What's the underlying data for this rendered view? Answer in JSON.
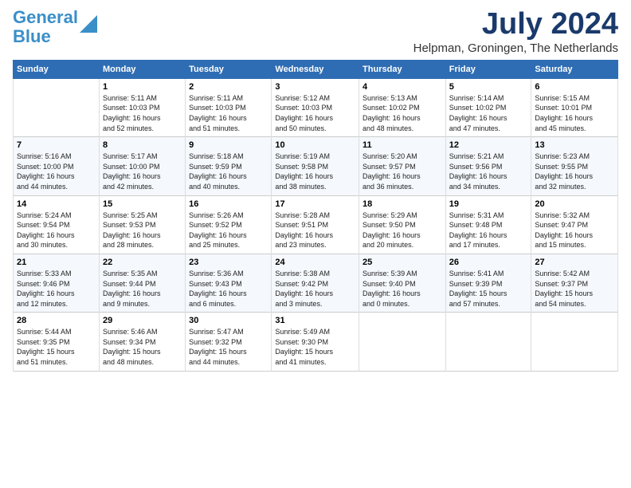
{
  "logo": {
    "line1": "General",
    "line2": "Blue"
  },
  "header": {
    "month": "July 2024",
    "location": "Helpman, Groningen, The Netherlands"
  },
  "days_of_week": [
    "Sunday",
    "Monday",
    "Tuesday",
    "Wednesday",
    "Thursday",
    "Friday",
    "Saturday"
  ],
  "weeks": [
    [
      {
        "num": "",
        "info": ""
      },
      {
        "num": "1",
        "info": "Sunrise: 5:11 AM\nSunset: 10:03 PM\nDaylight: 16 hours\nand 52 minutes."
      },
      {
        "num": "2",
        "info": "Sunrise: 5:11 AM\nSunset: 10:03 PM\nDaylight: 16 hours\nand 51 minutes."
      },
      {
        "num": "3",
        "info": "Sunrise: 5:12 AM\nSunset: 10:03 PM\nDaylight: 16 hours\nand 50 minutes."
      },
      {
        "num": "4",
        "info": "Sunrise: 5:13 AM\nSunset: 10:02 PM\nDaylight: 16 hours\nand 48 minutes."
      },
      {
        "num": "5",
        "info": "Sunrise: 5:14 AM\nSunset: 10:02 PM\nDaylight: 16 hours\nand 47 minutes."
      },
      {
        "num": "6",
        "info": "Sunrise: 5:15 AM\nSunset: 10:01 PM\nDaylight: 16 hours\nand 45 minutes."
      }
    ],
    [
      {
        "num": "7",
        "info": "Sunrise: 5:16 AM\nSunset: 10:00 PM\nDaylight: 16 hours\nand 44 minutes."
      },
      {
        "num": "8",
        "info": "Sunrise: 5:17 AM\nSunset: 10:00 PM\nDaylight: 16 hours\nand 42 minutes."
      },
      {
        "num": "9",
        "info": "Sunrise: 5:18 AM\nSunset: 9:59 PM\nDaylight: 16 hours\nand 40 minutes."
      },
      {
        "num": "10",
        "info": "Sunrise: 5:19 AM\nSunset: 9:58 PM\nDaylight: 16 hours\nand 38 minutes."
      },
      {
        "num": "11",
        "info": "Sunrise: 5:20 AM\nSunset: 9:57 PM\nDaylight: 16 hours\nand 36 minutes."
      },
      {
        "num": "12",
        "info": "Sunrise: 5:21 AM\nSunset: 9:56 PM\nDaylight: 16 hours\nand 34 minutes."
      },
      {
        "num": "13",
        "info": "Sunrise: 5:23 AM\nSunset: 9:55 PM\nDaylight: 16 hours\nand 32 minutes."
      }
    ],
    [
      {
        "num": "14",
        "info": "Sunrise: 5:24 AM\nSunset: 9:54 PM\nDaylight: 16 hours\nand 30 minutes."
      },
      {
        "num": "15",
        "info": "Sunrise: 5:25 AM\nSunset: 9:53 PM\nDaylight: 16 hours\nand 28 minutes."
      },
      {
        "num": "16",
        "info": "Sunrise: 5:26 AM\nSunset: 9:52 PM\nDaylight: 16 hours\nand 25 minutes."
      },
      {
        "num": "17",
        "info": "Sunrise: 5:28 AM\nSunset: 9:51 PM\nDaylight: 16 hours\nand 23 minutes."
      },
      {
        "num": "18",
        "info": "Sunrise: 5:29 AM\nSunset: 9:50 PM\nDaylight: 16 hours\nand 20 minutes."
      },
      {
        "num": "19",
        "info": "Sunrise: 5:31 AM\nSunset: 9:48 PM\nDaylight: 16 hours\nand 17 minutes."
      },
      {
        "num": "20",
        "info": "Sunrise: 5:32 AM\nSunset: 9:47 PM\nDaylight: 16 hours\nand 15 minutes."
      }
    ],
    [
      {
        "num": "21",
        "info": "Sunrise: 5:33 AM\nSunset: 9:46 PM\nDaylight: 16 hours\nand 12 minutes."
      },
      {
        "num": "22",
        "info": "Sunrise: 5:35 AM\nSunset: 9:44 PM\nDaylight: 16 hours\nand 9 minutes."
      },
      {
        "num": "23",
        "info": "Sunrise: 5:36 AM\nSunset: 9:43 PM\nDaylight: 16 hours\nand 6 minutes."
      },
      {
        "num": "24",
        "info": "Sunrise: 5:38 AM\nSunset: 9:42 PM\nDaylight: 16 hours\nand 3 minutes."
      },
      {
        "num": "25",
        "info": "Sunrise: 5:39 AM\nSunset: 9:40 PM\nDaylight: 16 hours\nand 0 minutes."
      },
      {
        "num": "26",
        "info": "Sunrise: 5:41 AM\nSunset: 9:39 PM\nDaylight: 15 hours\nand 57 minutes."
      },
      {
        "num": "27",
        "info": "Sunrise: 5:42 AM\nSunset: 9:37 PM\nDaylight: 15 hours\nand 54 minutes."
      }
    ],
    [
      {
        "num": "28",
        "info": "Sunrise: 5:44 AM\nSunset: 9:35 PM\nDaylight: 15 hours\nand 51 minutes."
      },
      {
        "num": "29",
        "info": "Sunrise: 5:46 AM\nSunset: 9:34 PM\nDaylight: 15 hours\nand 48 minutes."
      },
      {
        "num": "30",
        "info": "Sunrise: 5:47 AM\nSunset: 9:32 PM\nDaylight: 15 hours\nand 44 minutes."
      },
      {
        "num": "31",
        "info": "Sunrise: 5:49 AM\nSunset: 9:30 PM\nDaylight: 15 hours\nand 41 minutes."
      },
      {
        "num": "",
        "info": ""
      },
      {
        "num": "",
        "info": ""
      },
      {
        "num": "",
        "info": ""
      }
    ]
  ]
}
